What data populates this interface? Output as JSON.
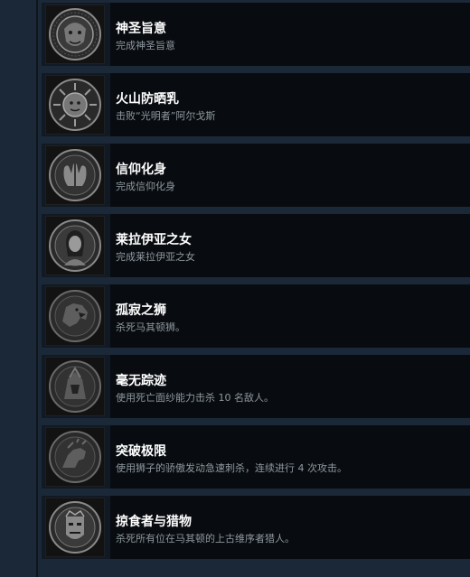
{
  "achievements": [
    {
      "title": "神圣旨意",
      "description": "完成神圣旨意",
      "icon": "lion-crest-icon"
    },
    {
      "title": "火山防晒乳",
      "description": "击败“光明者”阿尔戈斯",
      "icon": "sun-face-icon"
    },
    {
      "title": "信仰化身",
      "description": "完成信仰化身",
      "icon": "praying-hands-icon"
    },
    {
      "title": "莱拉伊亚之女",
      "description": "完成莱拉伊亚之女",
      "icon": "woman-portrait-icon"
    },
    {
      "title": "孤寂之狮",
      "description": "杀死马其顿狮。",
      "icon": "roaring-lion-icon"
    },
    {
      "title": "毫无踪迹",
      "description": "使用死亡面纱能力击杀 10 名敌人。",
      "icon": "veiled-warrior-icon"
    },
    {
      "title": "突破极限",
      "description": "使用狮子的骄傲发动急速刺杀，连续进行 4 次攻击。",
      "icon": "lion-charge-icon"
    },
    {
      "title": "掠食者与猎物",
      "description": "杀死所有位在马其顿的上古维序者猎人。",
      "icon": "masked-hunter-icon"
    }
  ],
  "colors": {
    "background": "#1b2838",
    "row": "#111a24",
    "text_panel": "#080c10",
    "title": "#ffffff",
    "description": "#8f98a0"
  }
}
